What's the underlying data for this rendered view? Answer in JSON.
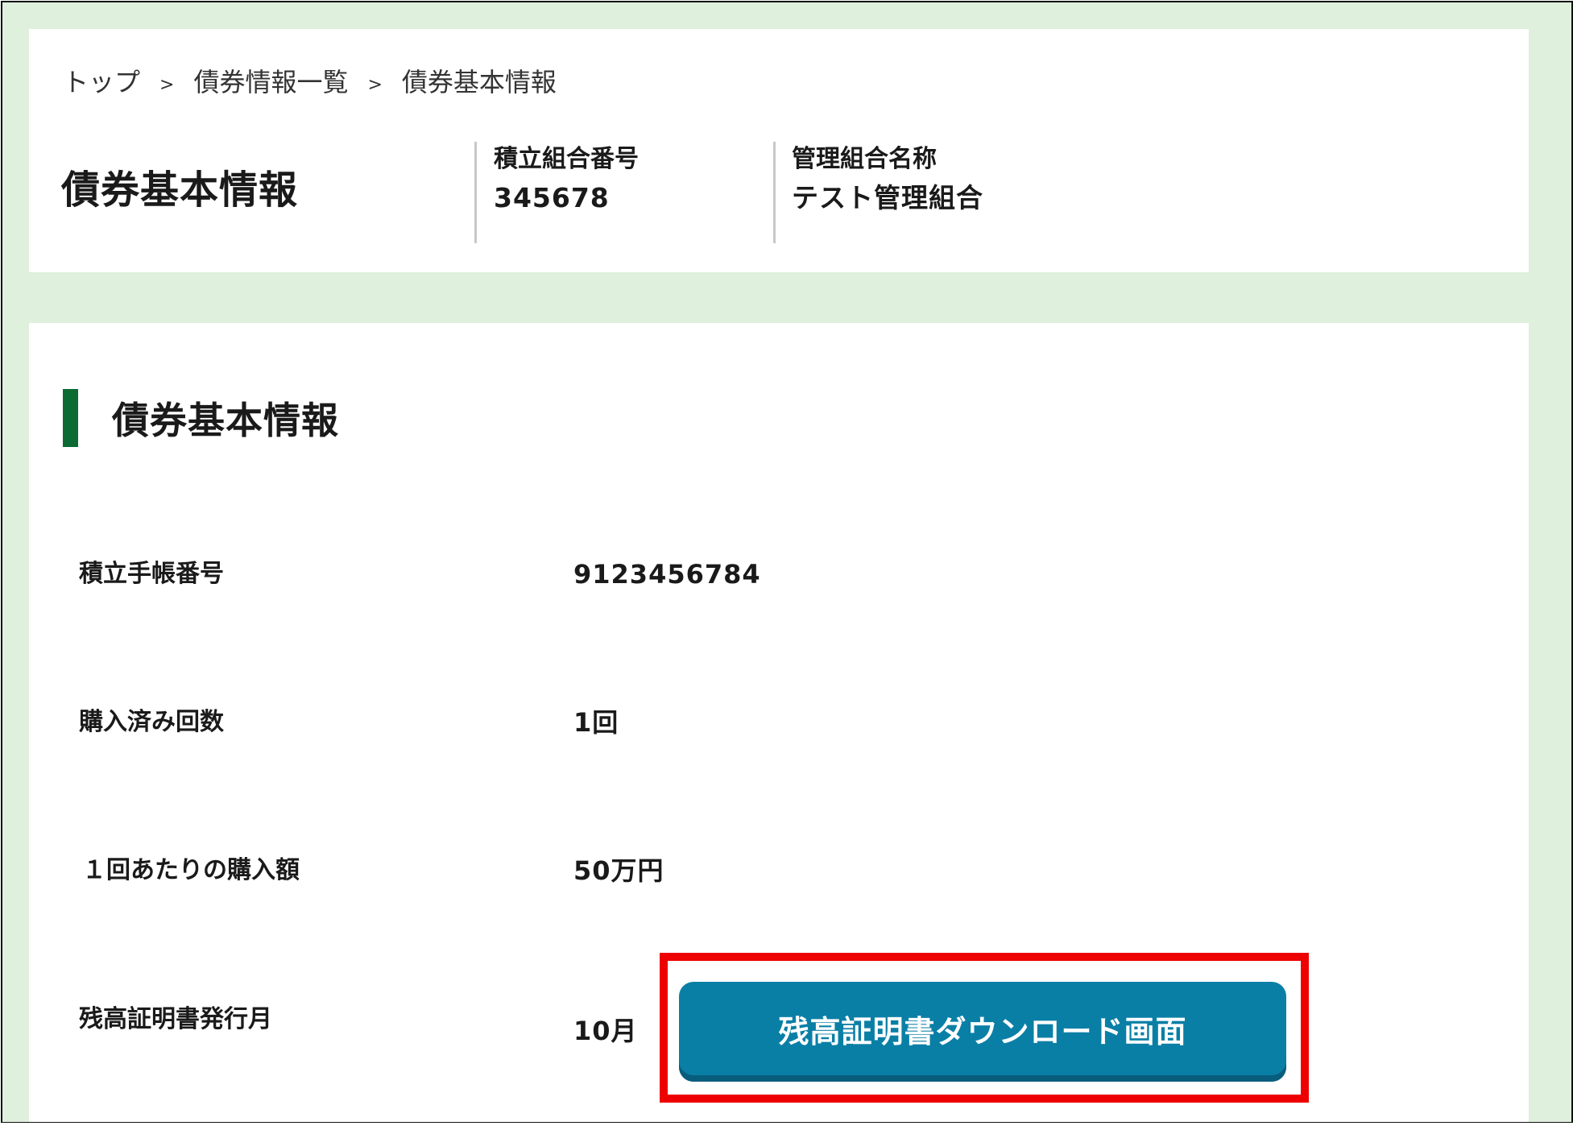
{
  "breadcrumb": {
    "items": [
      "トップ",
      "債券情報一覧",
      "債券基本情報"
    ],
    "separator": ">"
  },
  "header": {
    "title": "債券基本情報",
    "union_number_label": "積立組合番号",
    "union_number_value": "345678",
    "union_name_label": "管理組合名称",
    "union_name_value": "テスト管理組合"
  },
  "section": {
    "title": "債券基本情報",
    "rows": [
      {
        "label": "積立手帳番号",
        "value": "9123456784"
      },
      {
        "label": "購入済み回数",
        "value": "1回"
      },
      {
        "label": "１回あたりの購入額",
        "value": "50万円"
      },
      {
        "label": "残高証明書発行月",
        "value": "10月"
      }
    ]
  },
  "download_button": {
    "label": "残高証明書ダウンロード画面"
  },
  "colors": {
    "page_background": "#dff0dc",
    "accent_green": "#0b6b33",
    "button_blue": "#0a7fa6",
    "highlight_red": "#ee0000"
  }
}
